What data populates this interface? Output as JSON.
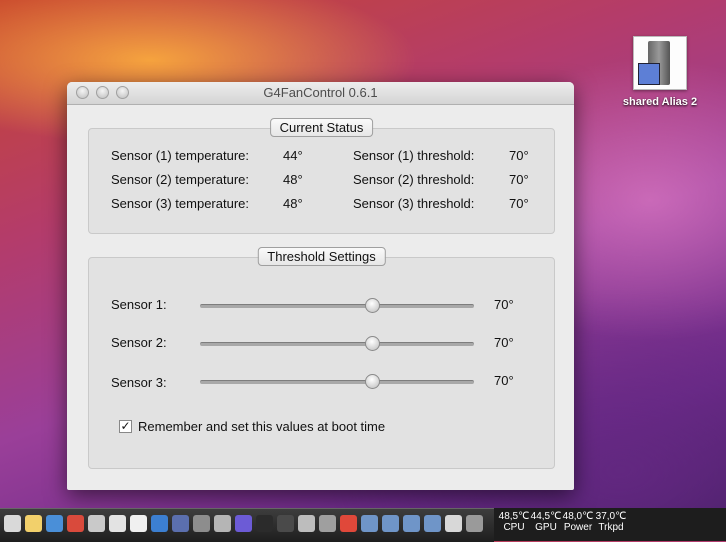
{
  "desktop": {
    "alias_label": "shared Alias 2"
  },
  "window": {
    "title": "G4FanControl 0.6.1",
    "current_status": {
      "label": "Current Status",
      "rows": [
        {
          "temp_label": "Sensor (1) temperature:",
          "temp_value": "44°",
          "threshold_label": "Sensor (1) threshold:",
          "threshold_value": "70°"
        },
        {
          "temp_label": "Sensor (2) temperature:",
          "temp_value": "48°",
          "threshold_label": "Sensor (2) threshold:",
          "threshold_value": "70°"
        },
        {
          "temp_label": "Sensor (3) temperature:",
          "temp_value": "48°",
          "threshold_label": "Sensor (3) threshold:",
          "threshold_value": "70°"
        }
      ]
    },
    "threshold_settings": {
      "label": "Threshold Settings",
      "sliders": [
        {
          "label": "Sensor 1:",
          "value_text": "70°",
          "position": 0.63
        },
        {
          "label": "Sensor 2:",
          "value_text": "70°",
          "position": 0.63
        },
        {
          "label": "Sensor 3:",
          "value_text": "70°",
          "position": 0.63
        }
      ],
      "remember_checkbox": {
        "label": "Remember and set this values at boot time",
        "checked": true
      }
    }
  },
  "dock": {
    "items": [
      "finder-icon",
      "notes-icon",
      "safari-icon",
      "app-icon",
      "folder-icon",
      "preview-icon",
      "scripts-icon",
      "network-icon",
      "mail-icon",
      "utility-icon",
      "microphone-icon",
      "settings-icon",
      "terminal-icon",
      "monitor-icon",
      "tool-icon",
      "grid-icon",
      "music-icon",
      "folder-icon",
      "folder-icon",
      "folder-icon",
      "folder-icon",
      "folder-icon",
      "trash-icon"
    ]
  },
  "stats": [
    {
      "value": "48,5℃",
      "label": "CPU"
    },
    {
      "value": "44,5℃",
      "label": "GPU"
    },
    {
      "value": "48,0℃",
      "label": "Power"
    },
    {
      "value": "37,0℃",
      "label": "Trkpd"
    }
  ]
}
